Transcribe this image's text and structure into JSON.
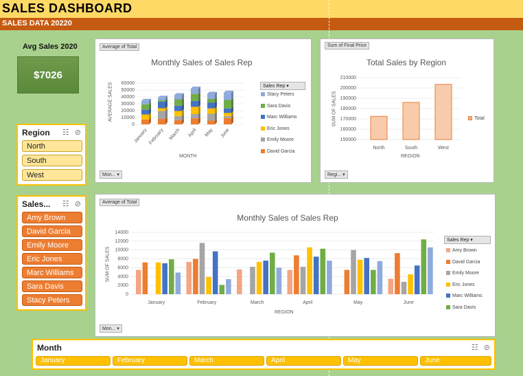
{
  "header": {
    "title": "SALES DASHBOARD",
    "subtitle": "SALES DATA 20220"
  },
  "avg": {
    "label": "Avg Sales 2020",
    "value": "$7026"
  },
  "slicer_region": {
    "title": "Region",
    "items": [
      "North",
      "South",
      "West"
    ]
  },
  "slicer_sales": {
    "title": "Sales...",
    "items": [
      "Amy Brown",
      "David Garcia",
      "Emily Moore",
      "Eric Jones",
      "Marc Williams",
      "Sara Davis",
      "Stacy Peters"
    ]
  },
  "slicer_month": {
    "title": "Month",
    "items": [
      "January",
      "February",
      "March",
      "April",
      "May",
      "June"
    ]
  },
  "icons": {
    "multiselect": "multiselect-icon",
    "clear_filter": "clear-filter-icon"
  },
  "colors": {
    "Amy Brown": "#f4a582",
    "David Garcia": "#ed7d31",
    "Emily Moore": "#a5a5a5",
    "Eric Jones": "#ffc000",
    "Marc Williams": "#4472c4",
    "Sara Davis": "#70ad47",
    "Stacy Peters": "#8faadc"
  },
  "chart1": {
    "pivot_tag": "Average of Total",
    "title": "Monthly Sales of Sales Rep",
    "xlabel": "MONTH",
    "ylabel": "AVERAGE SALES",
    "field_button": "Mon...",
    "legend_title": "Sales Rep",
    "legend": [
      "Stacy Peters",
      "Sara Davis",
      "Marc Williams",
      "Eric Jones",
      "Emily Moore",
      "David Garcia"
    ],
    "y_ticks": [
      "60000",
      "50000",
      "40000",
      "30000",
      "20000",
      "10000",
      "0"
    ]
  },
  "chart2": {
    "pivot_tag": "Sum of Final Price",
    "title": "Total Sales by Region",
    "xlabel": "REGION",
    "ylabel": "SUM OF SALES",
    "field_button": "Regi...",
    "legend": "Total",
    "y_ticks": [
      "210000",
      "200000",
      "190000",
      "180000",
      "170000",
      "160000",
      "150000"
    ]
  },
  "chart3": {
    "pivot_tag": "Average of Total",
    "title": "Monthly Sales of Sales Rep",
    "xlabel": "REGION",
    "ylabel": "SUM OF SALES",
    "field_button": "Mon...",
    "legend_title": "Sales Rep",
    "legend": [
      "Amy Brown",
      "David Garcia",
      "Emily Moore",
      "Eric Jones",
      "Marc Williams",
      "Sara Davis"
    ],
    "y_ticks": [
      "14000",
      "12000",
      "10000",
      "8000",
      "6000",
      "4000",
      "2000",
      "0"
    ]
  },
  "chart_data": [
    {
      "type": "bar",
      "title": "Monthly Sales of Sales Rep",
      "xlabel": "MONTH",
      "ylabel": "AVERAGE SALES",
      "stacked": true,
      "ylim": [
        0,
        60000
      ],
      "categories": [
        "January",
        "February",
        "March",
        "April",
        "May",
        "June"
      ],
      "series": [
        {
          "name": "David Garcia",
          "values": [
            7200,
            8000,
            6000,
            8800,
            5500,
            9300
          ]
        },
        {
          "name": "Emily Moore",
          "values": [
            0,
            11600,
            6200,
            6200,
            10000,
            2800
          ]
        },
        {
          "name": "Eric Jones",
          "values": [
            7200,
            3900,
            7300,
            10600,
            7800,
            4500
          ]
        },
        {
          "name": "Marc Williams",
          "values": [
            7000,
            9700,
            7600,
            8500,
            8200,
            6500
          ]
        },
        {
          "name": "Sara Davis",
          "values": [
            7900,
            2100,
            9400,
            10300,
            5500,
            12400
          ]
        },
        {
          "name": "Stacy Peters",
          "values": [
            4900,
            3400,
            6000,
            7600,
            7500,
            10600
          ]
        }
      ]
    },
    {
      "type": "bar",
      "title": "Total Sales by Region",
      "xlabel": "REGION",
      "ylabel": "SUM OF SALES",
      "ylim": [
        150000,
        210000
      ],
      "categories": [
        "North",
        "South",
        "West"
      ],
      "series": [
        {
          "name": "Total",
          "values": [
            172500,
            186000,
            203500
          ]
        }
      ]
    },
    {
      "type": "bar",
      "title": "Monthly Sales of Sales Rep",
      "xlabel": "REGION",
      "ylabel": "SUM OF SALES",
      "ylim": [
        0,
        14000
      ],
      "categories": [
        "January",
        "February",
        "March",
        "April",
        "May",
        "June"
      ],
      "series": [
        {
          "name": "Amy Brown",
          "values": [
            5500,
            7300,
            5600,
            5500,
            0,
            3500
          ]
        },
        {
          "name": "David Garcia",
          "values": [
            7200,
            8000,
            0,
            8800,
            5500,
            9300
          ]
        },
        {
          "name": "Emily Moore",
          "values": [
            0,
            11600,
            6200,
            6200,
            10000,
            2800
          ]
        },
        {
          "name": "Eric Jones",
          "values": [
            7200,
            3900,
            7300,
            10600,
            7800,
            4500
          ]
        },
        {
          "name": "Marc Williams",
          "values": [
            7000,
            9700,
            7600,
            8500,
            8200,
            6500
          ]
        },
        {
          "name": "Sara Davis",
          "values": [
            7900,
            2100,
            9400,
            10300,
            5500,
            12400
          ]
        },
        {
          "name": "Stacy Peters",
          "values": [
            4900,
            3400,
            6000,
            7600,
            7500,
            10600
          ]
        }
      ]
    }
  ]
}
